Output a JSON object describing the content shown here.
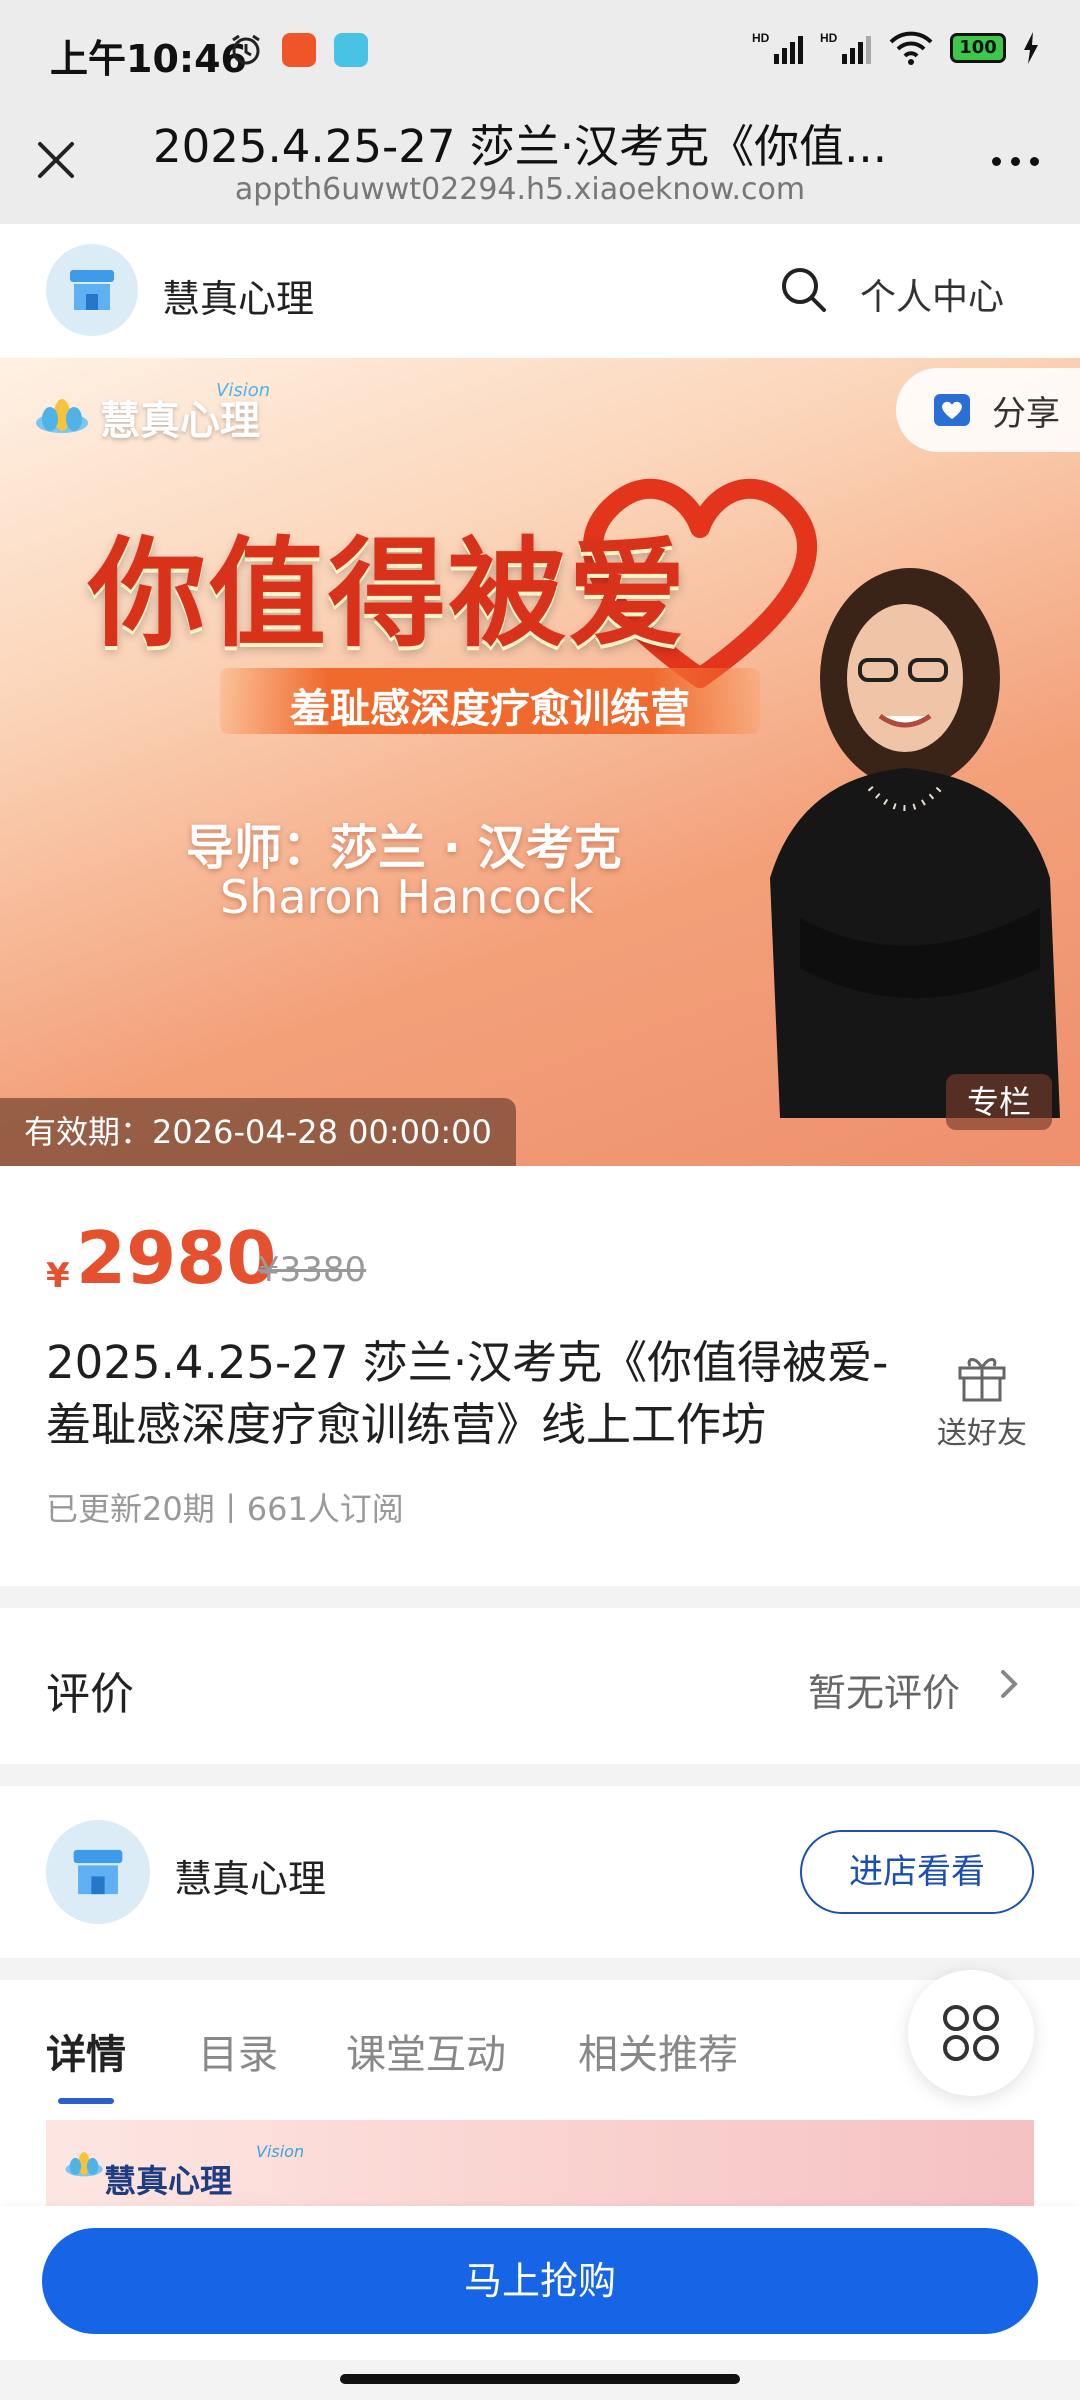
{
  "status_bar": {
    "time": "上午10:46",
    "signal1": "HD",
    "signal2": "HD",
    "battery": "100"
  },
  "browser": {
    "title": "2025.4.25-27 莎兰·汉考克《你值...",
    "url": "appth6uwwt02294.h5.xiaoeknow.com"
  },
  "shop_nav": {
    "shop_name": "慧真心理",
    "personal_center": "个人中心"
  },
  "banner": {
    "logo_text": "慧真心理",
    "logo_vision": "Vision",
    "headline": "你值得被爱",
    "subtitle": "羞耻感深度疗愈训练营",
    "tutor": "导师：莎兰 · 汉考克",
    "tutor_en": "Sharon Hancock",
    "share_label": "分享",
    "validity": "有效期：2026-04-28 00:00:00",
    "badge": "专栏"
  },
  "product": {
    "currency": "¥",
    "price": "2980",
    "original_price": "¥3380",
    "title": "2025.4.25-27 莎兰·汉考克《你值得被爱-羞耻感深度疗愈训练营》线上工作坊",
    "gift_label": "送好友",
    "meta": "已更新20期丨661人订阅"
  },
  "reviews": {
    "title": "评价",
    "empty_text": "暂无评价"
  },
  "shop_card": {
    "name": "慧真心理",
    "visit_label": "进店看看"
  },
  "tabs": {
    "items": [
      "详情",
      "目录",
      "课堂互动",
      "相关推荐"
    ],
    "active_index": 0
  },
  "detail": {
    "logo_text": "慧真心理",
    "logo_vision": "Vision"
  },
  "buy": {
    "label": "马上抢购"
  },
  "colors": {
    "price": "#e5502e",
    "primary": "#1565e6",
    "tab_underline": "#2b5fd0",
    "visit_border": "#1d4fb3"
  }
}
